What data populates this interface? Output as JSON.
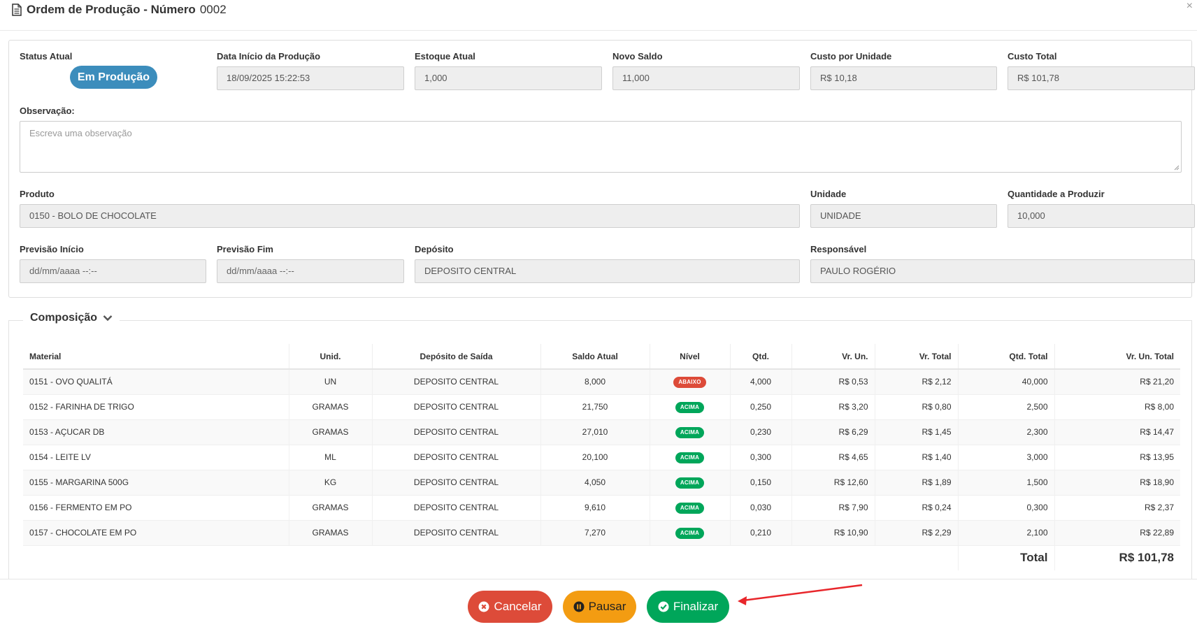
{
  "header": {
    "title": "Ordem de Produção - Número",
    "number": "0002",
    "close": "×"
  },
  "form": {
    "status_label": "Status Atual",
    "status_value": "Em Produção",
    "start_label": "Data Início da Produção",
    "start_value": "18/09/2025 15:22:53",
    "stock_label": "Estoque Atual",
    "stock_value": "1,000",
    "balance_label": "Novo Saldo",
    "balance_value": "11,000",
    "unit_cost_label": "Custo por Unidade",
    "unit_cost_value": "R$ 10,18",
    "total_cost_label": "Custo Total",
    "total_cost_value": "R$ 101,78",
    "obs_label": "Observação:",
    "obs_placeholder": "Escreva uma observação",
    "product_label": "Produto",
    "product_value": "0150 - BOLO DE CHOCOLATE",
    "unit_label": "Unidade",
    "unit_value": "UNIDADE",
    "qty_label": "Quantidade a Produzir",
    "qty_value": "10,000",
    "prev_start_label": "Previsão Início",
    "prev_start_value": "dd/mm/aaaa --:--",
    "prev_end_label": "Previsão Fim",
    "prev_end_value": "dd/mm/aaaa --:--",
    "deposit_label": "Depósito",
    "deposit_value": "DEPOSITO CENTRAL",
    "responsible_label": "Responsável",
    "responsible_value": "PAULO ROGÉRIO"
  },
  "composition": {
    "title": "Composição",
    "columns": [
      "Material",
      "Unid.",
      "Depósito de Saída",
      "Saldo Atual",
      "Nível",
      "Qtd.",
      "Vr. Un.",
      "Vr. Total",
      "Qtd. Total",
      "Vr. Un. Total"
    ],
    "rows": [
      {
        "material": "0151 - OVO QUALITÁ",
        "unit": "UN",
        "deposit": "DEPOSITO CENTRAL",
        "balance": "8,000",
        "level": "ABAIXO",
        "level_type": "low",
        "qty": "4,000",
        "unit_value": "R$ 0,53",
        "total_value": "R$ 2,12",
        "qty_total": "40,000",
        "unit_total": "R$ 21,20"
      },
      {
        "material": "0152 - FARINHA DE TRIGO",
        "unit": "GRAMAS",
        "deposit": "DEPOSITO CENTRAL",
        "balance": "21,750",
        "level": "ACIMA",
        "level_type": "ok",
        "qty": "0,250",
        "unit_value": "R$ 3,20",
        "total_value": "R$ 0,80",
        "qty_total": "2,500",
        "unit_total": "R$ 8,00"
      },
      {
        "material": "0153 - AÇUCAR DB",
        "unit": "GRAMAS",
        "deposit": "DEPOSITO CENTRAL",
        "balance": "27,010",
        "level": "ACIMA",
        "level_type": "ok",
        "qty": "0,230",
        "unit_value": "R$ 6,29",
        "total_value": "R$ 1,45",
        "qty_total": "2,300",
        "unit_total": "R$ 14,47"
      },
      {
        "material": "0154 - LEITE LV",
        "unit": "ML",
        "deposit": "DEPOSITO CENTRAL",
        "balance": "20,100",
        "level": "ACIMA",
        "level_type": "ok",
        "qty": "0,300",
        "unit_value": "R$ 4,65",
        "total_value": "R$ 1,40",
        "qty_total": "3,000",
        "unit_total": "R$ 13,95"
      },
      {
        "material": "0155 - MARGARINA 500G",
        "unit": "KG",
        "deposit": "DEPOSITO CENTRAL",
        "balance": "4,050",
        "level": "ACIMA",
        "level_type": "ok",
        "qty": "0,150",
        "unit_value": "R$ 12,60",
        "total_value": "R$ 1,89",
        "qty_total": "1,500",
        "unit_total": "R$ 18,90"
      },
      {
        "material": "0156 - FERMENTO EM PO",
        "unit": "GRAMAS",
        "deposit": "DEPOSITO CENTRAL",
        "balance": "9,610",
        "level": "ACIMA",
        "level_type": "ok",
        "qty": "0,030",
        "unit_value": "R$ 7,90",
        "total_value": "R$ 0,24",
        "qty_total": "0,300",
        "unit_total": "R$ 2,37"
      },
      {
        "material": "0157 - CHOCOLATE EM PO",
        "unit": "GRAMAS",
        "deposit": "DEPOSITO CENTRAL",
        "balance": "7,270",
        "level": "ACIMA",
        "level_type": "ok",
        "qty": "0,210",
        "unit_value": "R$ 10,90",
        "total_value": "R$ 2,29",
        "qty_total": "2,100",
        "unit_total": "R$ 22,89"
      }
    ],
    "total_label": "Total",
    "total_value": "R$ 101,78"
  },
  "footer": {
    "cancel_label": "Cancelar",
    "pause_label": "Pausar",
    "finish_label": "Finalizar"
  },
  "colors": {
    "primary": "#3c8dbc",
    "danger": "#dd4b39",
    "warning": "#f39c12",
    "success": "#00a65a",
    "annotation_arrow": "#e8262b"
  }
}
